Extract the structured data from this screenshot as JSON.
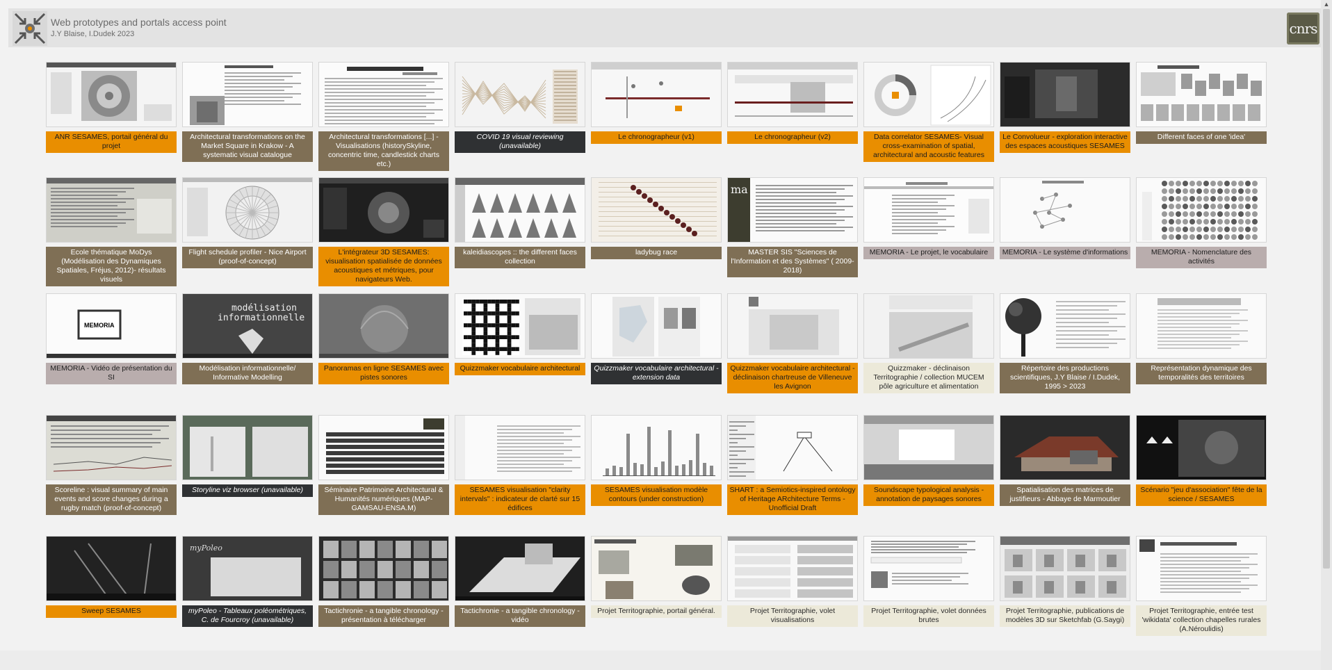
{
  "header": {
    "title": "Web prototypes and portals access point",
    "subtitle": "J.Y Blaise, I.Dudek 2023",
    "logo_text": "cnrs"
  },
  "colors": {
    "orange": "#e98e00",
    "brown": "#7f6f55",
    "dark": "#2f3133",
    "mauve": "#b9adad",
    "cream": "#ece9d9"
  },
  "cards": [
    {
      "label": "ANR SESAMES, portail général du projet",
      "style": "orange",
      "thumb": "radial-photo"
    },
    {
      "label": "Architectural transformations on the Market Square in Krakow - A systematic visual catalogue",
      "style": "brown",
      "thumb": "text-photo"
    },
    {
      "label": "Architectural transformations [...] - Visualisations (historySkyline, concentric time, candlestick charts etc.)",
      "style": "brown",
      "thumb": "text-doc"
    },
    {
      "label": "COVID 19 visual reviewing (unavailable)",
      "style": "dark",
      "thumb": "lines-chart"
    },
    {
      "label": "Le chronographeur (v1)",
      "style": "orange",
      "thumb": "chrono"
    },
    {
      "label": "Le chronographeur (v2)",
      "style": "orange",
      "thumb": "chrono2"
    },
    {
      "label": "Data correlator SESAMES- Visual cross-examination of spatial, architectural and acoustic features",
      "style": "orange",
      "thumb": "circle-diagram"
    },
    {
      "label": "Le Convolueur - exploration interactive des espaces acoustiques SESAMES",
      "style": "orange",
      "thumb": "dark-photo"
    },
    {
      "label": "Different faces of one 'idea'",
      "style": "brown",
      "thumb": "faces"
    },
    {
      "label": "Ecole thématique MoDys (Modélisation des Dynamiques Spatiales, Fréjus, 2012)- résultats visuels",
      "style": "brown",
      "thumb": "grey-doc"
    },
    {
      "label": "Flight schedule profiler - Nice Airport (proof-of-concept)",
      "style": "brown",
      "thumb": "radial-grey"
    },
    {
      "label": "L'intégrateur 3D SESAMES: visualisation spatialisée de données acoustiques et métriques, pour navigateurs Web.",
      "style": "orange",
      "thumb": "dark-3d"
    },
    {
      "label": "kaleidiascopes :: the different faces collection",
      "style": "brown",
      "thumb": "icons-grid"
    },
    {
      "label": "ladybug race",
      "style": "brown",
      "thumb": "ladybug"
    },
    {
      "label": "MASTER SIS \"Sciences de l'Information et des Systèmes\" ( 2009-2018)",
      "style": "brown",
      "thumb": "master"
    },
    {
      "label": "MEMORIA - Le projet, le vocabulaire",
      "style": "mauve",
      "thumb": "memoria-doc"
    },
    {
      "label": "MEMORIA - Le système d'informations",
      "style": "mauve",
      "thumb": "memoria-graph"
    },
    {
      "label": "MEMORIA - Nomenclature des activités",
      "style": "mauve",
      "thumb": "dots-grid"
    },
    {
      "label": "MEMORIA - Vidéo de présentation du SI",
      "style": "mauve",
      "thumb": "memoria-video"
    },
    {
      "label": "Modélisation informationnelle/ Informative Modelling",
      "style": "brown",
      "thumb": "modelisation"
    },
    {
      "label": "Panoramas en ligne SESAMES avec pistes sonores",
      "style": "orange",
      "thumb": "vault"
    },
    {
      "label": "Quizzmaker vocabulaire architectural",
      "style": "orange",
      "thumb": "qrcode"
    },
    {
      "label": "Quizzmaker vocabulaire architectural - extension data",
      "style": "dark",
      "thumb": "map-doc"
    },
    {
      "label": "Quizzmaker vocabulaire architectural - déclinaison chartreuse de Villeneuve les Avignon",
      "style": "orange",
      "thumb": "vocab"
    },
    {
      "label": "Quizzmaker - déclinaison Territographie / collection MUCEM pôle agriculture et alimentation",
      "style": "cream",
      "thumb": "mucem"
    },
    {
      "label": "Répertoire des productions scientifiques, J.Y Blaise / I.Dudek, 1995 > 2023",
      "style": "brown",
      "thumb": "tree"
    },
    {
      "label": "Représentation dynamique des temporalités des territoires",
      "style": "brown",
      "thumb": "text-page"
    },
    {
      "label": "Scoreline : visual summary of main events and score changes during a rugby match (proof-of-concept)",
      "style": "brown",
      "thumb": "scoreline"
    },
    {
      "label": "Storyline viz browser (unavailable)",
      "style": "dark",
      "thumb": "storyline"
    },
    {
      "label": "Séminaire Patrimoine Architectural & Humanités numériques (MAP-GAMSAU-ENSA.M)",
      "style": "brown",
      "thumb": "seminaire"
    },
    {
      "label": "SESAMES visualisation \"clarity intervals\" : indicateur de clarté sur 15 édifices",
      "style": "orange",
      "thumb": "clarity"
    },
    {
      "label": "SESAMES visualisation modèle contours (under construction)",
      "style": "orange",
      "thumb": "bar-chart"
    },
    {
      "label": "SHART : a Semiotics-inspired ontology of Heritage ARchitecture Terms - Unofficial Draft",
      "style": "orange",
      "thumb": "shart"
    },
    {
      "label": "Soundscape typological analysis - annotation de paysages sonores",
      "style": "orange",
      "thumb": "soundscape"
    },
    {
      "label": "Spatialisation des matrices de justifieurs - Abbaye de Marmoutier",
      "style": "brown",
      "thumb": "abbey"
    },
    {
      "label": "Scénario \"jeu d'association\" fête de la science / SESAMES",
      "style": "orange",
      "thumb": "dark-pano"
    },
    {
      "label": "Sweep SESAMES",
      "style": "orange",
      "thumb": "sweep"
    },
    {
      "label": "myPoleo - Tableaux poléométriques, C. de Fourcroy (unavailable)",
      "style": "dark",
      "thumb": "mypoleo"
    },
    {
      "label": "Tactichronie - a tangible chronology - présentation à télécharger",
      "style": "brown",
      "thumb": "tacti-grid"
    },
    {
      "label": "Tactichronie - a tangible chronology - vidéo",
      "style": "brown",
      "thumb": "tacti-video"
    },
    {
      "label": "Projet Territographie, portail général.",
      "style": "cream",
      "thumb": "territo"
    },
    {
      "label": "Projet Territographie, volet visualisations",
      "style": "cream",
      "thumb": "territo-vis"
    },
    {
      "label": "Projet Territographie, volet données brutes",
      "style": "cream",
      "thumb": "territo-data"
    },
    {
      "label": "Projet Territographie, publications de modèles 3D sur Sketchfab (G.Saygi)",
      "style": "cream",
      "thumb": "sketchfab"
    },
    {
      "label": "Projet Territographie, entrée test 'wikidata' collection chapelles rurales (A.Néroulidis)",
      "style": "cream",
      "thumb": "wikidata"
    }
  ]
}
